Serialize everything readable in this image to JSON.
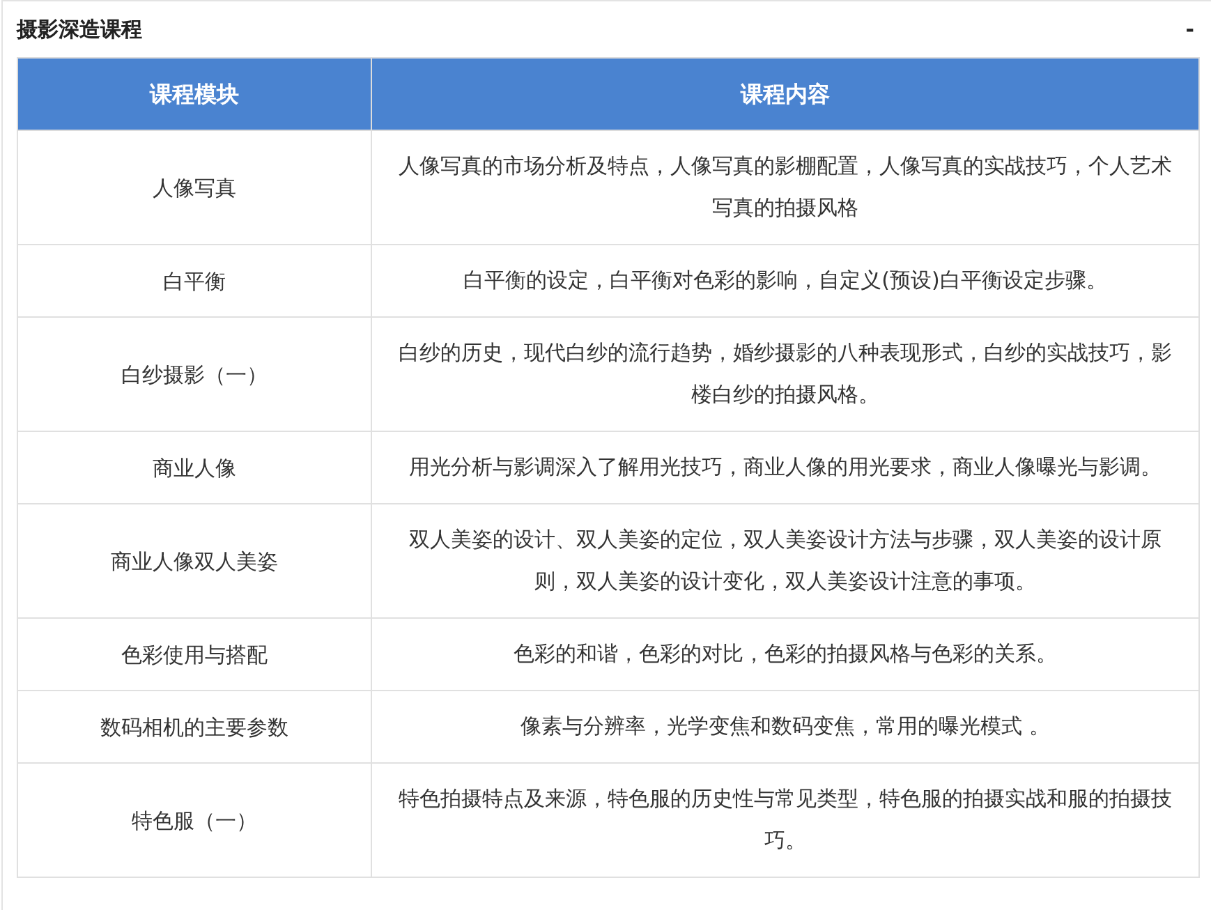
{
  "panel": {
    "title": "摄影深造课程",
    "collapse_toggle": "-"
  },
  "table": {
    "columns": [
      "课程模块",
      "课程内容"
    ],
    "rows": [
      {
        "module": "人像写真",
        "content": "人像写真的市场分析及特点，人像写真的影棚配置，人像写真的实战技巧，个人艺术写真的拍摄风格"
      },
      {
        "module": "白平衡",
        "content": "白平衡的设定，白平衡对色彩的影响，自定义(预设)白平衡设定步骤。"
      },
      {
        "module": "白纱摄影（一）",
        "content": "白纱的历史，现代白纱的流行趋势，婚纱摄影的八种表现形式，白纱的实战技巧，影楼白纱的拍摄风格。"
      },
      {
        "module": "商业人像",
        "content": "用光分析与影调深入了解用光技巧，商业人像的用光要求，商业人像曝光与影调。"
      },
      {
        "module": "商业人像双人美姿",
        "content": "双人美姿的设计、双人美姿的定位，双人美姿设计方法与步骤，双人美姿的设计原则，双人美姿的设计变化，双人美姿设计注意的事项。"
      },
      {
        "module": "色彩使用与搭配",
        "content": "色彩的和谐，色彩的对比，色彩的拍摄风格与色彩的关系。"
      },
      {
        "module": "数码相机的主要参数",
        "content": "像素与分辨率，光学变焦和数码变焦，常用的曝光模式 。"
      },
      {
        "module": "特色服（一）",
        "content": "特色拍摄特点及来源，特色服的历史性与常见类型，特色服的拍摄实战和服的拍摄技巧。"
      }
    ]
  }
}
